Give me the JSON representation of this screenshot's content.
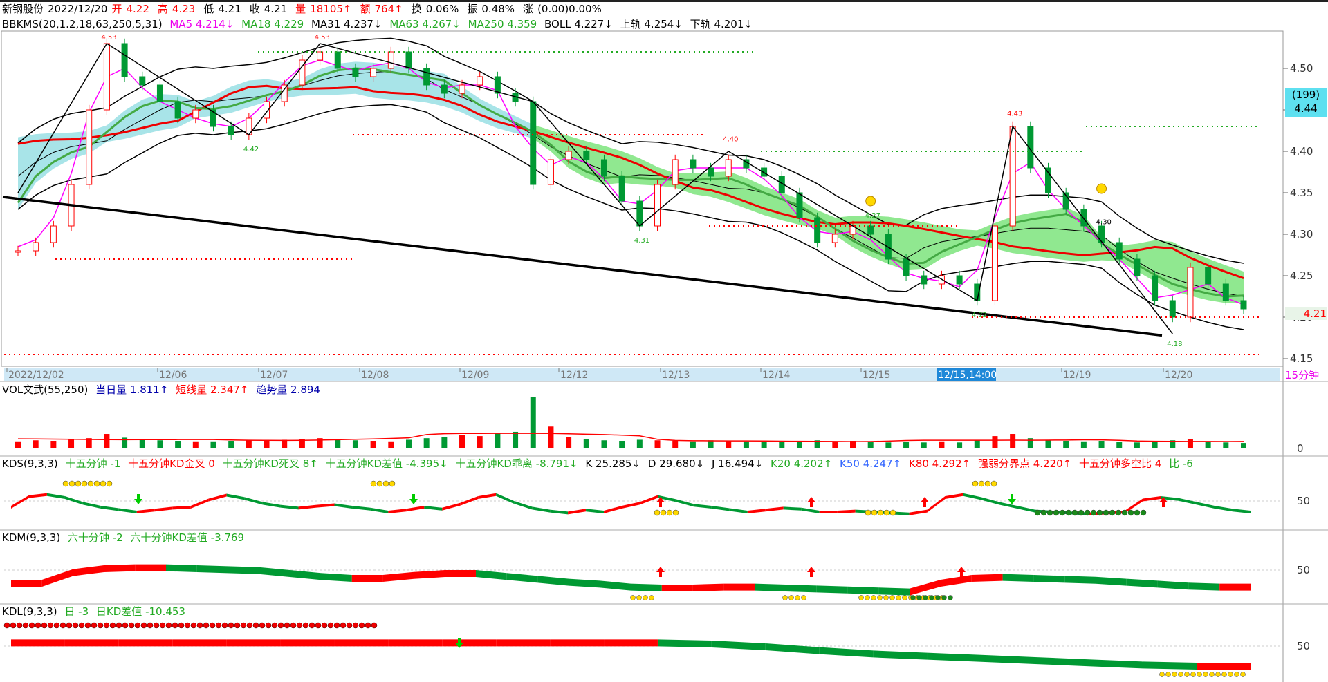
{
  "header": {
    "stock": "新钢股份",
    "date": "2022/12/20",
    "open_label": "开",
    "open": "4.22",
    "high_label": "高",
    "high": "4.23",
    "low_label": "低",
    "low": "4.21",
    "close_label": "收",
    "close": "4.21",
    "vol_label": "量",
    "vol": "18105↑",
    "amt_label": "额",
    "amt": "764↑",
    "turn_label": "换",
    "turn": "0.06%",
    "amp_label": "振",
    "amp": "0.48%",
    "chg_label": "涨",
    "chg": "(0.00)0.00%"
  },
  "main_ind": {
    "name": "BBKMS(20,1.2,18,63,250,5,31)",
    "ma5": "MA5 4.214↓",
    "ma18": "MA18 4.229",
    "ma31": "MA31 4.237↓",
    "ma63": "MA63 4.267↓",
    "ma250": "MA250 4.359",
    "boll": "BOLL 4.227↓",
    "upper": "上轨 4.254↓",
    "lower": "下轨 4.201↓"
  },
  "price_axis": {
    "ticks": [
      "4.50",
      "4.45",
      "4.40",
      "4.35",
      "4.30",
      "4.25",
      "4.20",
      "4.15"
    ],
    "ylim": [
      4.145,
      4.545
    ],
    "badge_top": "(199)",
    "badge_price": "4.44",
    "current": "4.21"
  },
  "date_axis": {
    "labels": [
      "2022/12/02",
      "12/06",
      "12/07",
      "12/08",
      "12/09",
      "12/12",
      "12/13",
      "12/14",
      "12/15",
      "12/19",
      "12/20"
    ],
    "highlight": "12/15,14:00",
    "period": "15分钟"
  },
  "price_annotations": [
    "4.53",
    "4.53",
    "4.42",
    "4.31",
    "4.40",
    "4.27",
    "4.22",
    "4.43",
    "4.30",
    "4.18"
  ],
  "vol_ind": {
    "name": "VOL文武(55,250)",
    "day": "当日量 1.811↑",
    "short": "短线量 2.347↑",
    "trend": "趋势量 2.894",
    "axis": "0"
  },
  "kds_ind": {
    "name": "KDS(9,3,3)",
    "a": "十五分钟 -1",
    "b": "十五分钟KD金叉 0",
    "c": "十五分钟KD死叉 8↑",
    "d": "十五分钟KD差值 -4.395↓",
    "e": "十五分钟KD乖离 -8.791↓",
    "k": "K 25.285↓",
    "dv": "D 29.680↓",
    "j": "J 16.494↓",
    "k20": "K20 4.202↑",
    "k50": "K50 4.247↑",
    "k80": "K80 4.292↑",
    "qr": "强弱分界点 4.220↑",
    "f": "十五分钟多空比 4",
    "g": "比 -6",
    "axis": "50"
  },
  "kdm_ind": {
    "name": "KDM(9,3,3)",
    "a": "六十分钟 -2",
    "b": "六十分钟KD差值 -3.769",
    "axis": "50"
  },
  "kdl_ind": {
    "name": "KDL(9,3,3)",
    "a": "日 -3",
    "b": "日KD差值 -10.453",
    "axis": "50"
  },
  "colors": {
    "up": "#ff0000",
    "down": "#009933",
    "cyan": "#a8e4e8",
    "green_band": "#90e890",
    "magenta": "#ff00ff"
  },
  "chart_data": {
    "type": "candlestick",
    "ylim": [
      4.145,
      4.545
    ],
    "price_path": [
      4.28,
      4.29,
      4.31,
      4.36,
      4.45,
      4.53,
      4.49,
      4.48,
      4.46,
      4.44,
      4.45,
      4.43,
      4.42,
      4.44,
      4.46,
      4.48,
      4.51,
      4.52,
      4.5,
      4.49,
      4.5,
      4.52,
      4.5,
      4.48,
      4.47,
      4.48,
      4.49,
      4.47,
      4.46,
      4.36,
      4.39,
      4.4,
      4.39,
      4.37,
      4.34,
      4.31,
      4.36,
      4.39,
      4.38,
      4.37,
      4.39,
      4.38,
      4.37,
      4.35,
      4.32,
      4.29,
      4.3,
      4.31,
      4.3,
      4.27,
      4.25,
      4.24,
      4.25,
      4.24,
      4.22,
      4.31,
      4.43,
      4.38,
      4.35,
      4.33,
      4.31,
      4.29,
      4.27,
      4.25,
      4.22,
      4.2,
      4.26,
      4.24,
      4.22,
      4.21
    ],
    "volume": [
      1.2,
      1.4,
      1.3,
      1.5,
      1.8,
      2.6,
      1.9,
      1.6,
      1.4,
      1.3,
      1.2,
      1.2,
      1.3,
      1.4,
      1.3,
      1.5,
      1.6,
      1.8,
      1.5,
      1.4,
      1.3,
      1.2,
      1.5,
      1.8,
      2.0,
      2.4,
      2.2,
      2.7,
      3.0,
      9.5,
      4.0,
      2.0,
      1.6,
      1.4,
      1.3,
      1.5,
      1.4,
      1.3,
      1.2,
      1.4,
      1.3,
      1.2,
      1.2,
      1.1,
      1.3,
      1.4,
      1.2,
      1.3,
      1.1,
      1.0,
      1.1,
      1.0,
      1.2,
      1.0,
      1.4,
      2.2,
      2.6,
      1.8,
      1.4,
      1.3,
      1.2,
      1.3,
      1.1,
      1.0,
      1.2,
      1.4,
      1.6,
      1.2,
      1.0,
      0.9
    ],
    "kds": [
      40,
      62,
      66,
      60,
      48,
      40,
      35,
      30,
      34,
      38,
      40,
      55,
      65,
      58,
      48,
      42,
      38,
      42,
      45,
      40,
      36,
      30,
      34,
      40,
      36,
      46,
      60,
      66,
      50,
      38,
      32,
      28,
      34,
      30,
      40,
      48,
      62,
      54,
      44,
      40,
      35,
      30,
      34,
      38,
      36,
      30,
      30,
      32,
      30,
      28,
      26,
      32,
      60,
      66,
      58,
      48,
      40,
      32,
      30,
      28,
      26,
      28,
      30,
      55,
      60,
      56,
      48,
      40,
      34,
      30
    ],
    "kdm": [
      30,
      30,
      52,
      60,
      62,
      62,
      60,
      58,
      56,
      50,
      44,
      40,
      40,
      46,
      50,
      50,
      44,
      38,
      32,
      28,
      22,
      20,
      20,
      22,
      22,
      20,
      18,
      16,
      14,
      12,
      30,
      40,
      42,
      40,
      38,
      36,
      32,
      28,
      24,
      22,
      22
    ],
    "kdl": [
      62,
      62,
      62,
      62,
      62,
      62,
      62,
      62,
      62,
      62,
      62,
      62,
      62,
      60,
      55,
      48,
      42,
      38,
      34,
      30,
      26,
      22,
      20,
      20
    ]
  }
}
